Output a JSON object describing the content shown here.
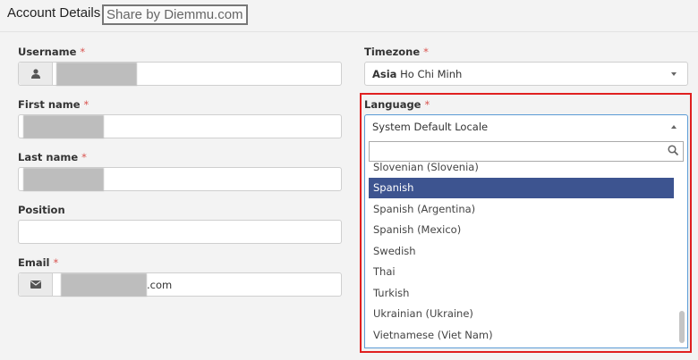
{
  "header": {
    "title": "Account Details",
    "watermark": "Share by Diemmu.com"
  },
  "left": {
    "username_label": "Username",
    "firstname_label": "First name",
    "lastname_label": "Last name",
    "position_label": "Position",
    "email_label": "Email",
    "email_suffix": ".com",
    "required_mark": "*"
  },
  "right": {
    "timezone_label": "Timezone",
    "timezone_region": "Asia",
    "timezone_city": "Ho Chi Minh",
    "language_label": "Language",
    "language_value": "System Default Locale"
  },
  "dropdown": {
    "search_value": "",
    "options": [
      "Slovenian (Slovenia)",
      "Spanish",
      "Spanish (Argentina)",
      "Spanish (Mexico)",
      "Swedish",
      "Thai",
      "Turkish",
      "Ukrainian (Ukraine)",
      "Vietnamese (Viet Nam)"
    ],
    "selected": "Spanish"
  },
  "icons": {
    "user": "user-icon",
    "email": "envelope-icon",
    "search": "search-icon"
  },
  "colors": {
    "required": "#d9534f",
    "selected_option": "#3d5490",
    "highlight_border": "#e02020",
    "focus_border": "#5b9bd5"
  }
}
